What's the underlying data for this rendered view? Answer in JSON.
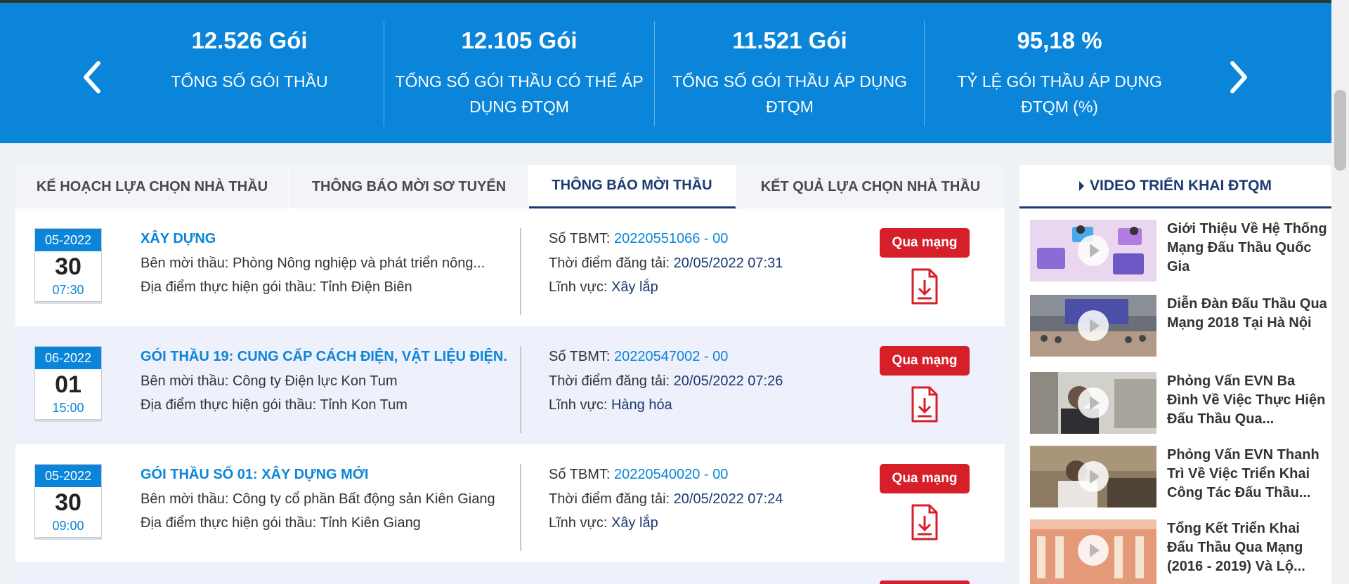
{
  "stats": {
    "items": [
      {
        "value": "12.526 Gói",
        "label": "TỔNG SỐ GÓI THẦU"
      },
      {
        "value": "12.105 Gói",
        "label": "TỔNG SỐ GÓI THẦU CÓ THỂ ÁP DỤNG ĐTQM"
      },
      {
        "value": "11.521 Gói",
        "label": "TỔNG SỐ GÓI THẦU ÁP DỤNG ĐTQM"
      },
      {
        "value": "95,18 %",
        "label": "TỶ LỆ GÓI THẦU ÁP DỤNG ĐTQM (%)"
      }
    ],
    "bg_color": "#0a85d9"
  },
  "tabs": [
    {
      "label": "KẾ HOẠCH LỰA CHỌN NHÀ THẦU"
    },
    {
      "label": "THÔNG BÁO MỜI SƠ TUYỂN"
    },
    {
      "label": "THÔNG BÁO MỜI THẦU",
      "active": true
    },
    {
      "label": "KẾT QUẢ LỰA CHỌN NHÀ THẦU"
    }
  ],
  "labels": {
    "inviter": "Bên mời thầu: ",
    "location": "Địa điểm thực hiện gói thầu: ",
    "tbmt": "Số TBMT: ",
    "posted": "Thời điểm đăng tải: ",
    "field": "Lĩnh vực: "
  },
  "notices": [
    {
      "month": "05-2022",
      "day": "30",
      "time": "07:30",
      "title": "XÂY DỰNG",
      "inviter": "Phòng Nông nghiệp và phát triển nông...",
      "location": "Tỉnh Điện Biên",
      "tbmt": "20220551066 - 00",
      "posted": "20/05/2022 07:31",
      "field": "Xây lắp",
      "button": "Qua mạng"
    },
    {
      "month": "06-2022",
      "day": "01",
      "time": "15:00",
      "title": "GÓI THẦU 19: CUNG CẤP CÁCH ĐIỆN, VẬT LIỆU ĐIỆN.",
      "inviter": "Công ty Điện lực Kon Tum",
      "location": "Tỉnh Kon Tum",
      "tbmt": "20220547002 - 00",
      "posted": "20/05/2022 07:26",
      "field": "Hàng hóa",
      "button": "Qua mạng"
    },
    {
      "month": "05-2022",
      "day": "30",
      "time": "09:00",
      "title": "GÓI THẦU SỐ 01: XÂY DỰNG MỚI",
      "inviter": "Công ty cổ phần Bất động sản Kiên Giang",
      "location": "Tỉnh Kiên Giang",
      "tbmt": "20220540020 - 00",
      "posted": "20/05/2022 07:24",
      "field": "Xây lắp",
      "button": "Qua mạng"
    }
  ],
  "sidebar": {
    "title": "VIDEO TRIỂN KHAI ĐTQM",
    "videos": [
      {
        "title": "Giới Thiệu Về Hệ Thống Mạng Đấu Thầu Quốc Gia"
      },
      {
        "title": "Diễn Đàn Đấu Thầu Qua Mạng 2018 Tại Hà Nội"
      },
      {
        "title": "Phỏng Vấn EVN Ba Đình Về Việc Thực Hiện Đấu Thầu Qua..."
      },
      {
        "title": "Phỏng Vấn EVN Thanh Trì Về Việc Triển Khai Công Tác Đấu Thầu..."
      },
      {
        "title": "Tổng Kết Triển Khai Đấu Thầu Qua Mạng (2016 - 2019) Và Lộ..."
      }
    ]
  },
  "colors": {
    "accent": "#0a85d9",
    "navy": "#1a3a72",
    "red": "#d71f2a"
  }
}
